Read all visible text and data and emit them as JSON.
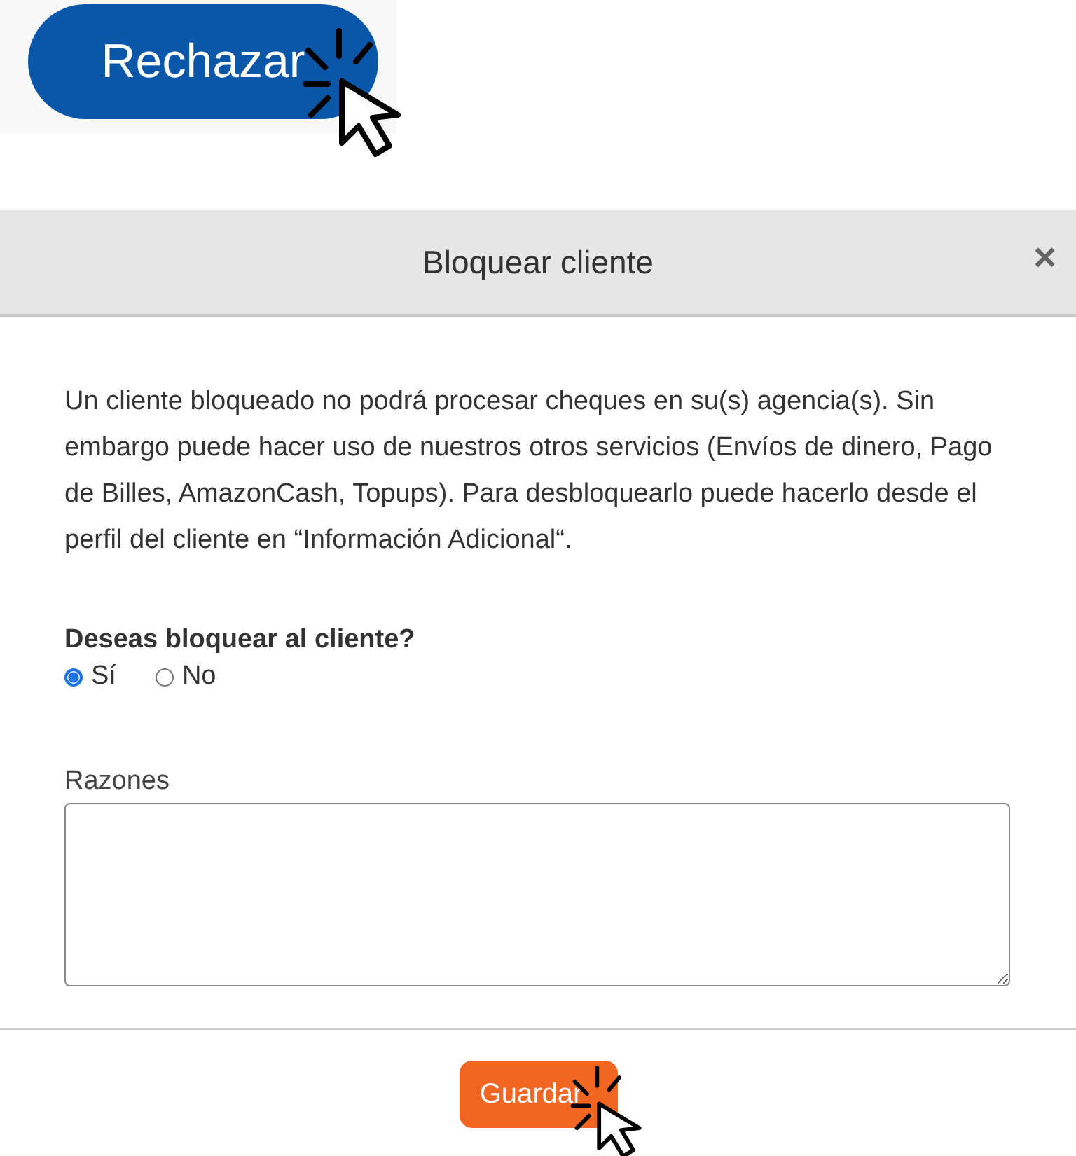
{
  "reject_button": {
    "label": "Rechazar"
  },
  "modal": {
    "title": "Bloquear cliente",
    "close": "×",
    "message": "Un cliente bloqueado no podrá procesar cheques en su(s) agencia(s). Sin embargo puede hacer uso de nuestros otros servicios (Envíos de dinero, Pago de Billes, AmazonCash, Topups). Para desbloquearlo puede hacerlo desde el perfil del cliente en “Información Adicional“.",
    "question": "Deseas bloquear al cliente?",
    "options": [
      {
        "label": "Sí",
        "selected": true
      },
      {
        "label": "No",
        "selected": false
      }
    ],
    "reasons_label": "Razones",
    "save_button": "Guardar"
  }
}
